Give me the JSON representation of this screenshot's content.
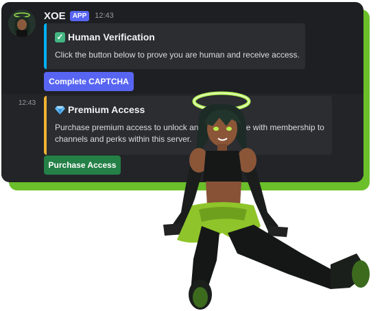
{
  "message": {
    "username": "XOE",
    "badge": "APP",
    "timestamp": "12:43"
  },
  "embed1": {
    "title": "Human Verification",
    "title_icon": "check-mark-icon",
    "description": "Click the button below to prove you are human and receive access.",
    "bar_color": "#00b0f4"
  },
  "button1": {
    "label": "Complete CAPTCHA",
    "color": "#5865f2"
  },
  "second_message": {
    "timestamp": "12:43"
  },
  "embed2": {
    "title": "Premium Access",
    "title_icon": "gem-icon",
    "description_line1": "Purchase premium access to unlock an exclusive role with membership to",
    "description_line2": "channels and perks within this server.",
    "bar_color": "#f0b232"
  },
  "button2": {
    "label": "Purchase Access",
    "color": "#248046"
  },
  "colors": {
    "card_bg": "#1e1f22",
    "accent_green": "#6bbf2a",
    "embed_bg": "#2b2d31"
  }
}
